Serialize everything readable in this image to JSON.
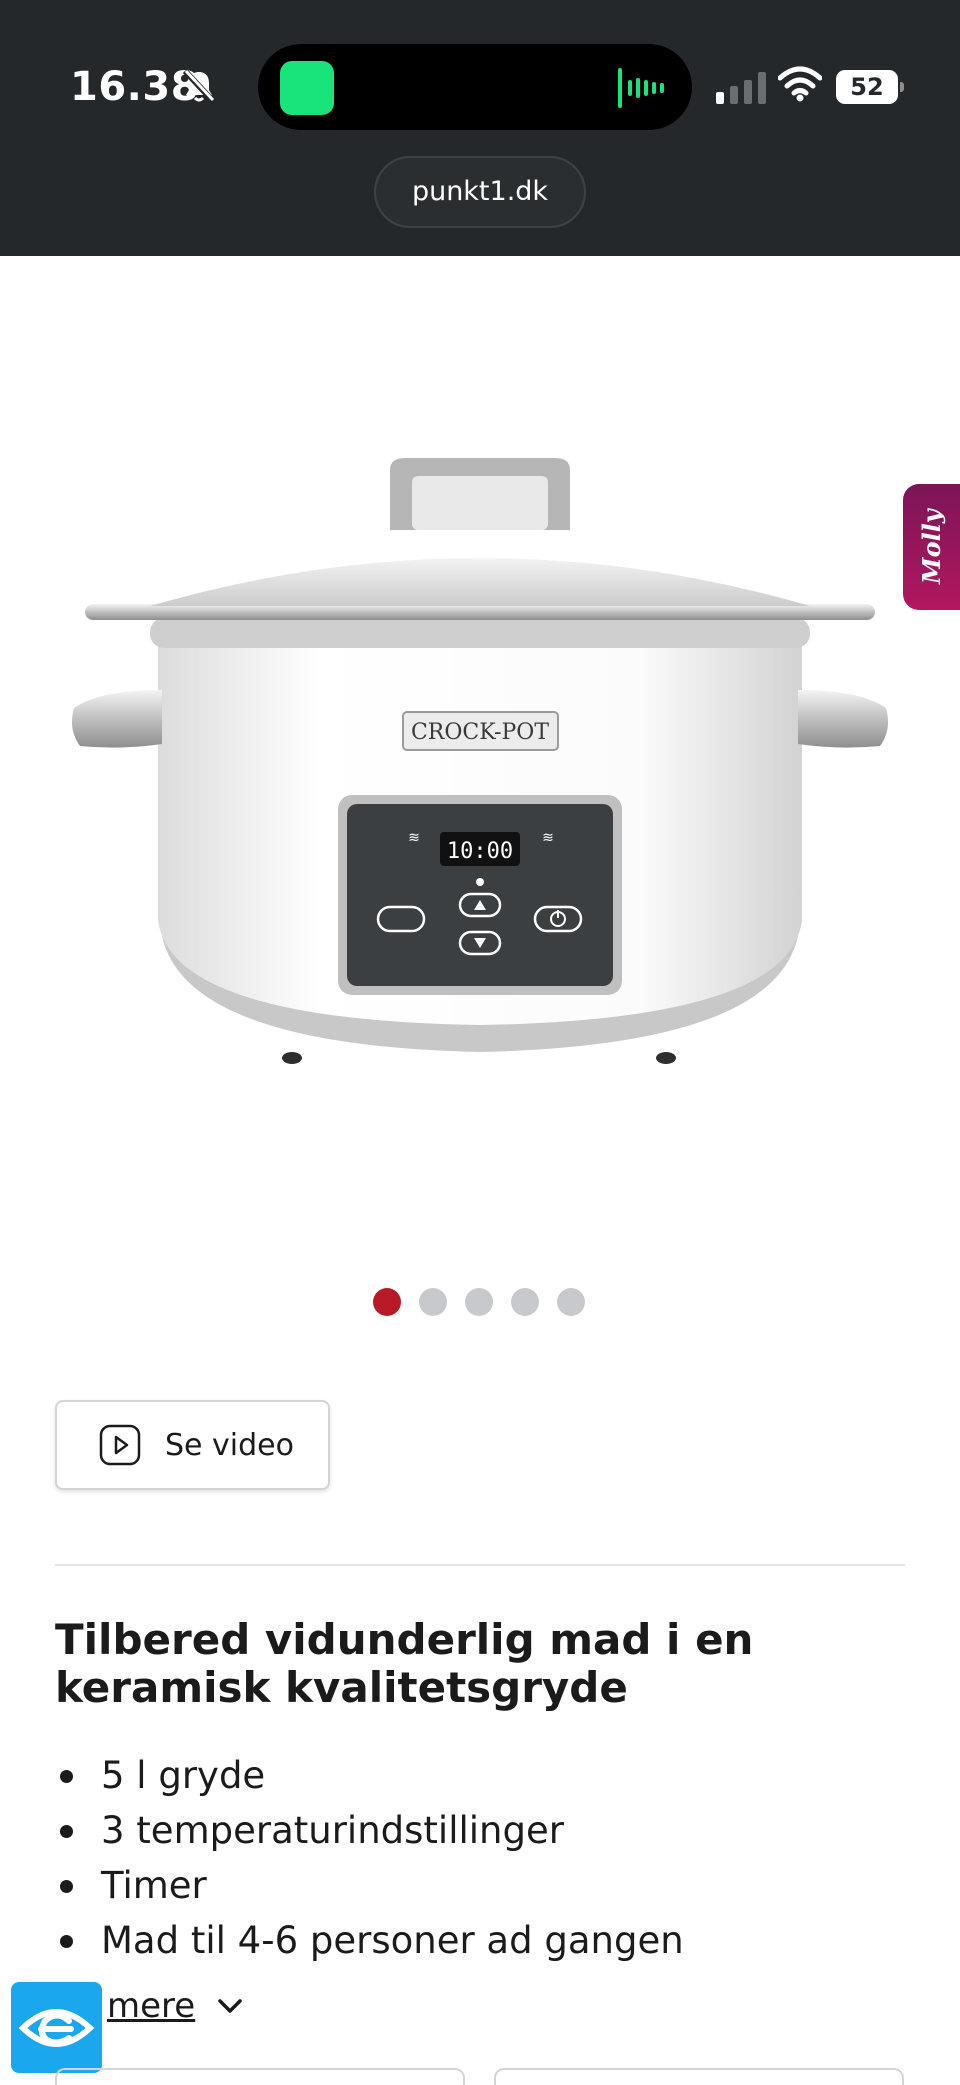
{
  "status_bar": {
    "time": "16.38",
    "battery": "52",
    "icons": [
      "bell-slash-icon",
      "cellular-signal-icon",
      "wifi-icon",
      "battery-icon"
    ]
  },
  "dynamic_island": {
    "app_icon": "app-icon",
    "activity_icon": "audio-bars-icon",
    "activity_color": "#19e37b"
  },
  "browser": {
    "url": "punkt1.dk"
  },
  "product_image": {
    "brand_text": "CROCK-POT",
    "display_time": "10:00"
  },
  "side_tab": {
    "label": "Molly"
  },
  "carousel": {
    "total": 5,
    "active_index": 0,
    "active_color": "#b81b25"
  },
  "video_button": {
    "label": "Se video",
    "icon": "play-icon"
  },
  "description": {
    "headline": "Tilbered vidunderlig mad i en keramisk kvalitetsgryde",
    "features": [
      "5 l gryde",
      "3 temperaturindstillinger",
      "Timer",
      "Mad til 4-6 personer ad gangen"
    ],
    "more_label": "mere",
    "more_icon": "chevron-down-icon"
  },
  "accessibility_badge": {
    "icon": "eye-icon",
    "color": "#1aa7ee"
  }
}
